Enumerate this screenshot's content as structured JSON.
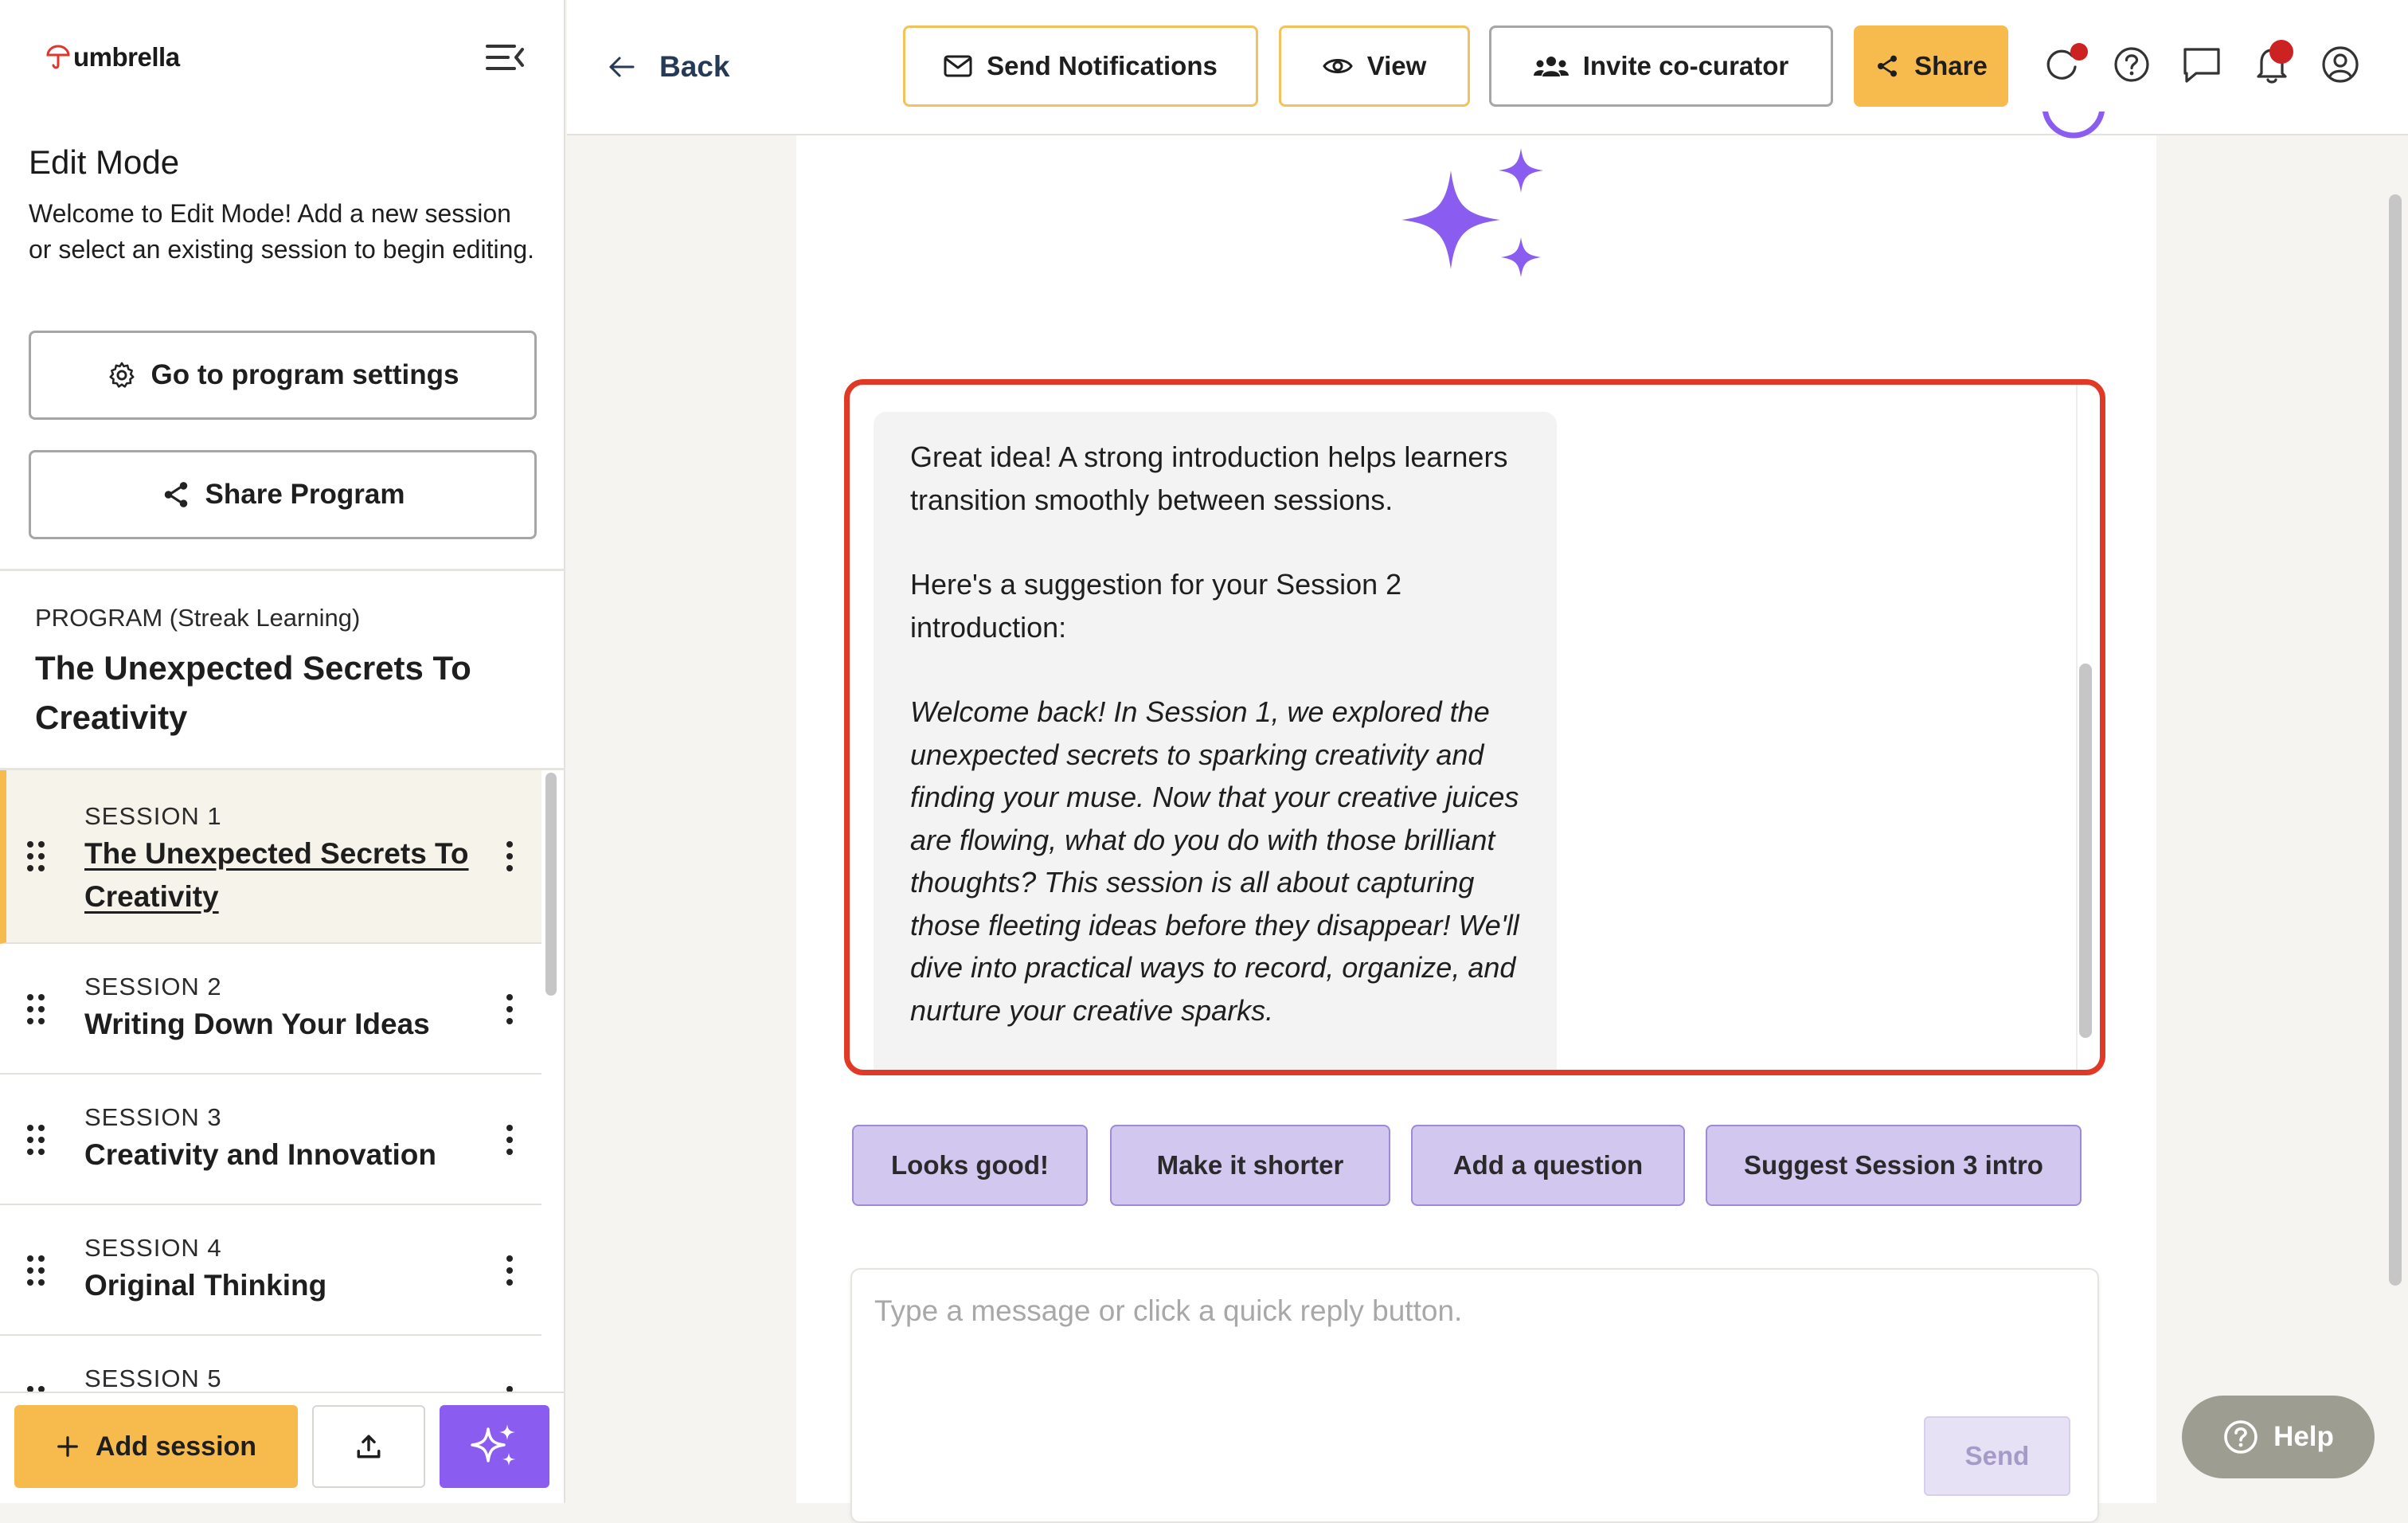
{
  "app": {
    "logo_text": "umbrella"
  },
  "sidebar": {
    "heading": "Edit Mode",
    "description": "Welcome to Edit Mode! Add a new session or select an existing session to begin editing.",
    "program_settings_label": "Go to program settings",
    "share_program_label": "Share Program",
    "program_label": "PROGRAM (Streak Learning)",
    "program_title": "The Unexpected Secrets To Creativity",
    "sessions": [
      {
        "label": "SESSION 1",
        "title": "The Unexpected Secrets To Creativity",
        "active": true
      },
      {
        "label": "SESSION 2",
        "title": "Writing Down Your Ideas",
        "active": false
      },
      {
        "label": "SESSION 3",
        "title": "Creativity and Innovation",
        "active": false
      },
      {
        "label": "SESSION 4",
        "title": "Original Thinking",
        "active": false
      },
      {
        "label": "SESSION 5",
        "title": "",
        "active": false
      }
    ],
    "add_session_label": "Add session"
  },
  "topbar": {
    "back_label": "Back",
    "send_notifications_label": "Send Notifications",
    "view_label": "View",
    "invite_label": "Invite co-curator",
    "share_label": "Share"
  },
  "chat": {
    "message_paragraph_1": "Great idea! A strong introduction helps learners transition smoothly between sessions.",
    "message_paragraph_2": "Here's a suggestion for your Session 2 introduction:",
    "message_paragraph_3": "Welcome back! In Session 1, we explored the unexpected secrets to sparking creativity and finding your muse. Now that your creative juices are flowing, what do you do with those brilliant thoughts? This session is all about capturing those fleeting ideas before they disappear! We'll dive into practical ways to record, organize, and nurture your creative sparks.",
    "quick_replies": [
      "Looks good!",
      "Make it shorter",
      "Add a question",
      "Suggest Session 3 intro"
    ],
    "composer_placeholder": "Type a message or click a quick reply button.",
    "send_label": "Send"
  },
  "help": {
    "label": "Help"
  },
  "colors": {
    "accent_yellow": "#f7bb4d",
    "accent_purple": "#8a5cf0",
    "highlight_red": "#e03a26",
    "quick_reply_bg": "#d2c7ef",
    "notification_dot": "#cc2222"
  }
}
